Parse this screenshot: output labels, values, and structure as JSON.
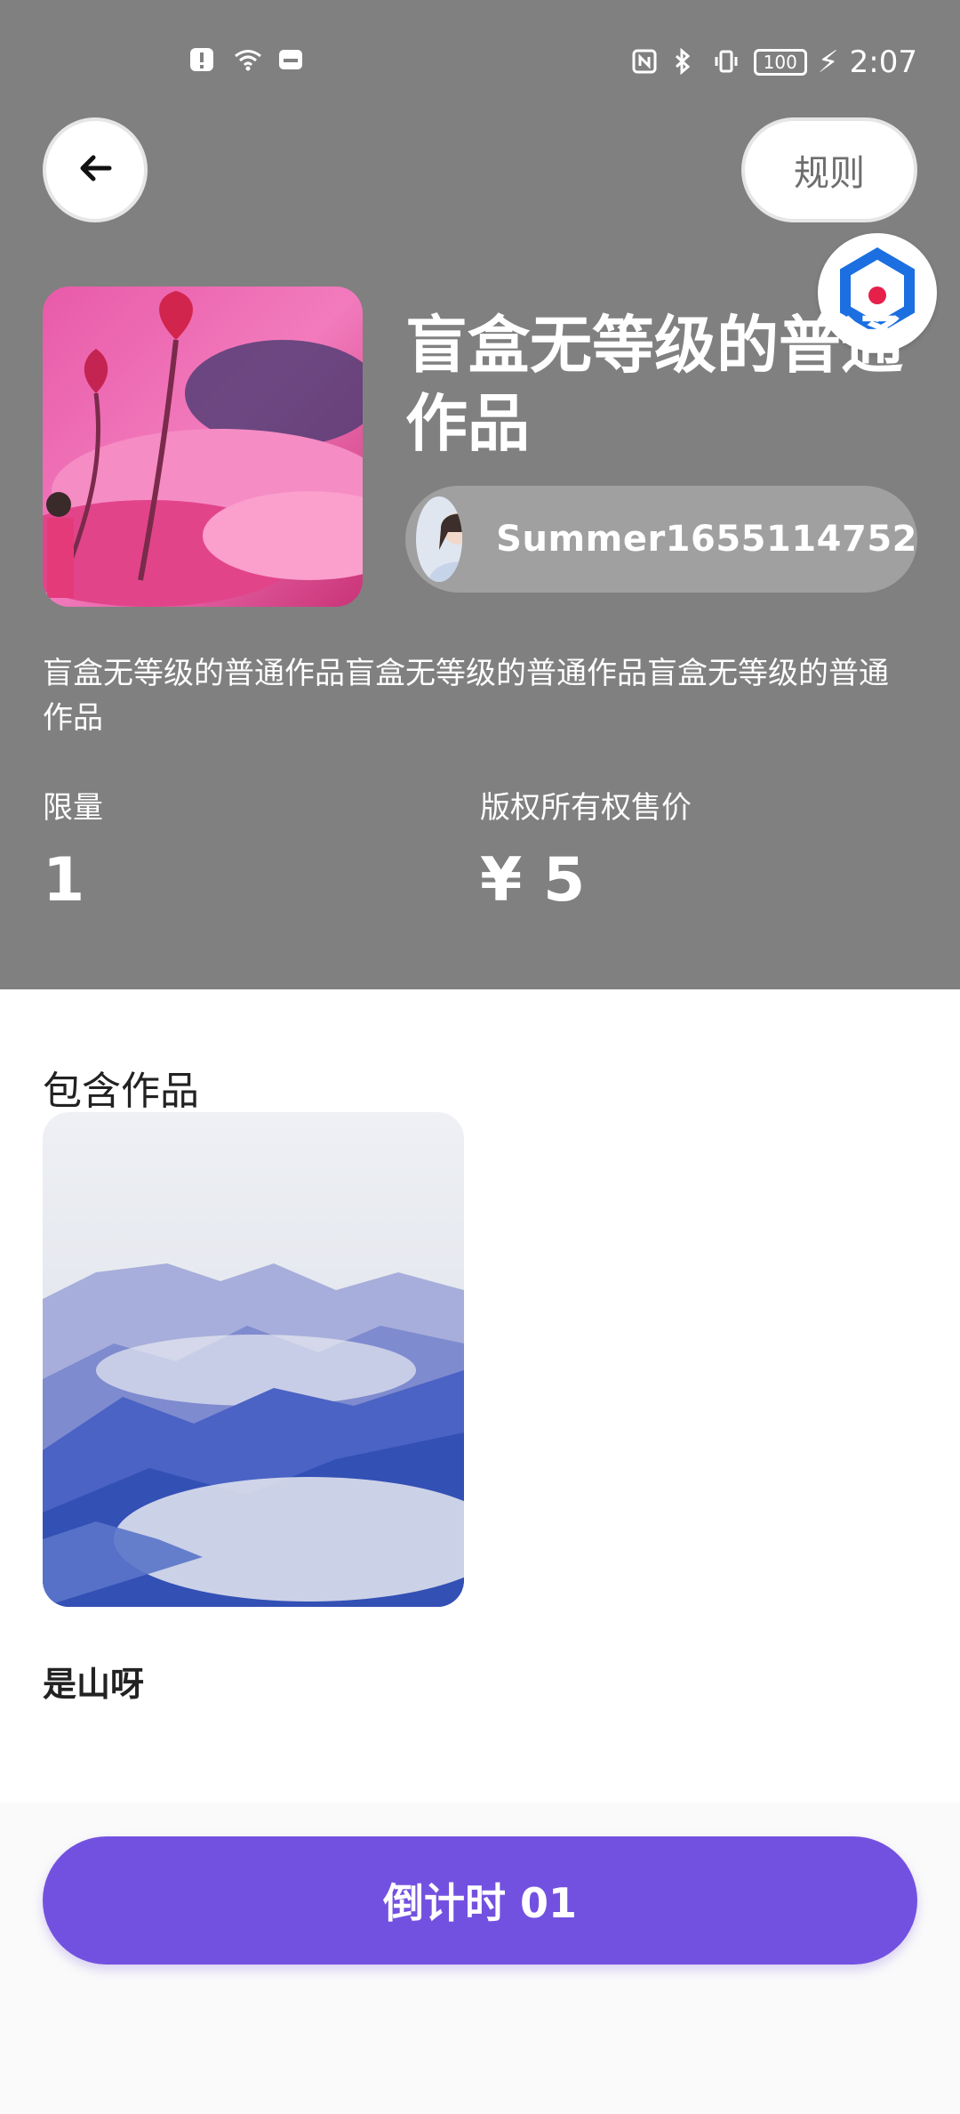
{
  "status_bar": {
    "left_icons": [
      "alert-icon",
      "wifi-icon",
      "sim-icon"
    ],
    "right_icons": [
      "nfc-icon",
      "bluetooth-icon",
      "vibrate-icon"
    ],
    "battery": "100",
    "time": "2:07"
  },
  "header": {
    "rules_label": "规则",
    "title": "盲盒无等级的普通作品",
    "creator": {
      "name": "Summer1655114752",
      "badge": "V"
    },
    "description": "盲盒无等级的普通作品盲盒无等级的普通作品盲盒无等级的普通作品",
    "stats": {
      "limit_label": "限量",
      "limit_value": "1",
      "price_label": "版权所有权售价",
      "price_value": "¥ 5"
    }
  },
  "content": {
    "section_title": "包含作品",
    "works": [
      {
        "name": "是山呀"
      }
    ]
  },
  "cta": {
    "label": "倒计时 01"
  },
  "colors": {
    "header_bg": "#808080",
    "accent": "#7351E0",
    "footer_bg": "#FAFAFA",
    "text_dark": "#222222"
  }
}
